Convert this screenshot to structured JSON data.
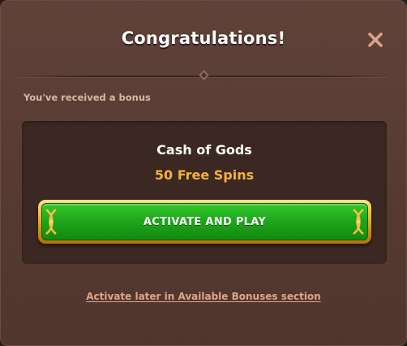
{
  "dialog": {
    "title": "Congratulations!",
    "close_icon": "close-icon",
    "subtitle": "You've received a bonus"
  },
  "bonus": {
    "game_name": "Cash of Gods",
    "value": "50 Free Spins",
    "activate_label": "ACTIVATE AND PLAY"
  },
  "footer": {
    "later_link": "Activate later in Available Bonuses section"
  },
  "colors": {
    "background": "#5f4138",
    "panel": "#3c2823",
    "accent_gold": "#f2b23a",
    "button_green": "#1fa81c",
    "link": "#e0a48a",
    "close_icon": "#d9a38e"
  }
}
